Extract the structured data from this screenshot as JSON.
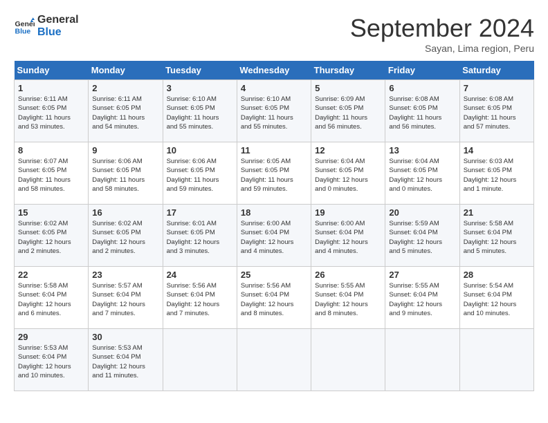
{
  "header": {
    "logo_line1": "General",
    "logo_line2": "Blue",
    "month": "September 2024",
    "location": "Sayan, Lima region, Peru"
  },
  "days_of_week": [
    "Sunday",
    "Monday",
    "Tuesday",
    "Wednesday",
    "Thursday",
    "Friday",
    "Saturday"
  ],
  "weeks": [
    [
      {
        "day": "1",
        "info": "Sunrise: 6:11 AM\nSunset: 6:05 PM\nDaylight: 11 hours\nand 53 minutes."
      },
      {
        "day": "2",
        "info": "Sunrise: 6:11 AM\nSunset: 6:05 PM\nDaylight: 11 hours\nand 54 minutes."
      },
      {
        "day": "3",
        "info": "Sunrise: 6:10 AM\nSunset: 6:05 PM\nDaylight: 11 hours\nand 55 minutes."
      },
      {
        "day": "4",
        "info": "Sunrise: 6:10 AM\nSunset: 6:05 PM\nDaylight: 11 hours\nand 55 minutes."
      },
      {
        "day": "5",
        "info": "Sunrise: 6:09 AM\nSunset: 6:05 PM\nDaylight: 11 hours\nand 56 minutes."
      },
      {
        "day": "6",
        "info": "Sunrise: 6:08 AM\nSunset: 6:05 PM\nDaylight: 11 hours\nand 56 minutes."
      },
      {
        "day": "7",
        "info": "Sunrise: 6:08 AM\nSunset: 6:05 PM\nDaylight: 11 hours\nand 57 minutes."
      }
    ],
    [
      {
        "day": "8",
        "info": "Sunrise: 6:07 AM\nSunset: 6:05 PM\nDaylight: 11 hours\nand 58 minutes."
      },
      {
        "day": "9",
        "info": "Sunrise: 6:06 AM\nSunset: 6:05 PM\nDaylight: 11 hours\nand 58 minutes."
      },
      {
        "day": "10",
        "info": "Sunrise: 6:06 AM\nSunset: 6:05 PM\nDaylight: 11 hours\nand 59 minutes."
      },
      {
        "day": "11",
        "info": "Sunrise: 6:05 AM\nSunset: 6:05 PM\nDaylight: 11 hours\nand 59 minutes."
      },
      {
        "day": "12",
        "info": "Sunrise: 6:04 AM\nSunset: 6:05 PM\nDaylight: 12 hours\nand 0 minutes."
      },
      {
        "day": "13",
        "info": "Sunrise: 6:04 AM\nSunset: 6:05 PM\nDaylight: 12 hours\nand 0 minutes."
      },
      {
        "day": "14",
        "info": "Sunrise: 6:03 AM\nSunset: 6:05 PM\nDaylight: 12 hours\nand 1 minute."
      }
    ],
    [
      {
        "day": "15",
        "info": "Sunrise: 6:02 AM\nSunset: 6:05 PM\nDaylight: 12 hours\nand 2 minutes."
      },
      {
        "day": "16",
        "info": "Sunrise: 6:02 AM\nSunset: 6:05 PM\nDaylight: 12 hours\nand 2 minutes."
      },
      {
        "day": "17",
        "info": "Sunrise: 6:01 AM\nSunset: 6:05 PM\nDaylight: 12 hours\nand 3 minutes."
      },
      {
        "day": "18",
        "info": "Sunrise: 6:00 AM\nSunset: 6:04 PM\nDaylight: 12 hours\nand 4 minutes."
      },
      {
        "day": "19",
        "info": "Sunrise: 6:00 AM\nSunset: 6:04 PM\nDaylight: 12 hours\nand 4 minutes."
      },
      {
        "day": "20",
        "info": "Sunrise: 5:59 AM\nSunset: 6:04 PM\nDaylight: 12 hours\nand 5 minutes."
      },
      {
        "day": "21",
        "info": "Sunrise: 5:58 AM\nSunset: 6:04 PM\nDaylight: 12 hours\nand 5 minutes."
      }
    ],
    [
      {
        "day": "22",
        "info": "Sunrise: 5:58 AM\nSunset: 6:04 PM\nDaylight: 12 hours\nand 6 minutes."
      },
      {
        "day": "23",
        "info": "Sunrise: 5:57 AM\nSunset: 6:04 PM\nDaylight: 12 hours\nand 7 minutes."
      },
      {
        "day": "24",
        "info": "Sunrise: 5:56 AM\nSunset: 6:04 PM\nDaylight: 12 hours\nand 7 minutes."
      },
      {
        "day": "25",
        "info": "Sunrise: 5:56 AM\nSunset: 6:04 PM\nDaylight: 12 hours\nand 8 minutes."
      },
      {
        "day": "26",
        "info": "Sunrise: 5:55 AM\nSunset: 6:04 PM\nDaylight: 12 hours\nand 8 minutes."
      },
      {
        "day": "27",
        "info": "Sunrise: 5:55 AM\nSunset: 6:04 PM\nDaylight: 12 hours\nand 9 minutes."
      },
      {
        "day": "28",
        "info": "Sunrise: 5:54 AM\nSunset: 6:04 PM\nDaylight: 12 hours\nand 10 minutes."
      }
    ],
    [
      {
        "day": "29",
        "info": "Sunrise: 5:53 AM\nSunset: 6:04 PM\nDaylight: 12 hours\nand 10 minutes."
      },
      {
        "day": "30",
        "info": "Sunrise: 5:53 AM\nSunset: 6:04 PM\nDaylight: 12 hours\nand 11 minutes."
      },
      {
        "day": "",
        "info": ""
      },
      {
        "day": "",
        "info": ""
      },
      {
        "day": "",
        "info": ""
      },
      {
        "day": "",
        "info": ""
      },
      {
        "day": "",
        "info": ""
      }
    ]
  ]
}
